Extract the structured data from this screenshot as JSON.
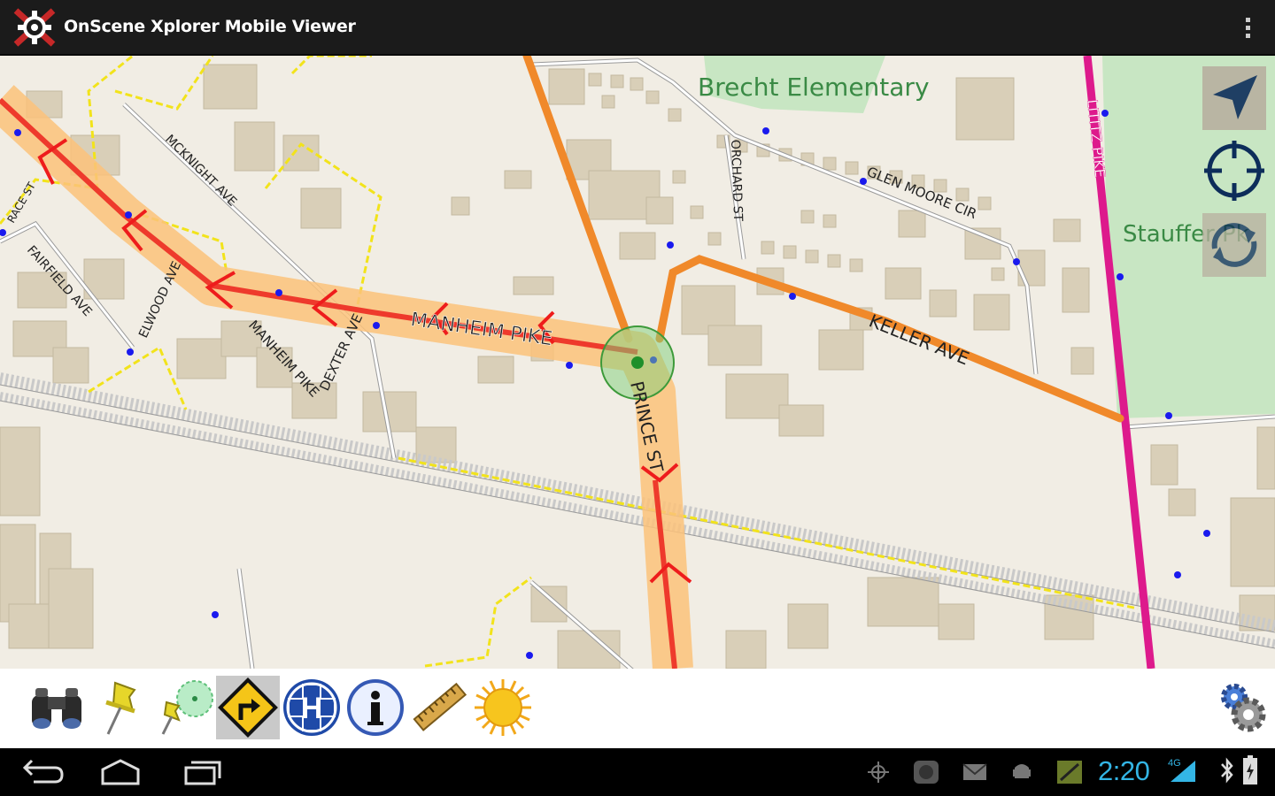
{
  "app": {
    "title": "OnScene Xplorer Mobile Viewer",
    "icon": "onscene-logo-icon"
  },
  "actionbar": {
    "overflow_icon": "overflow-menu-icon"
  },
  "map": {
    "labels": {
      "school": "Brecht Elementary",
      "park": "Stauffer Pk",
      "manheim_pike_main": "MANHEIM PIKE",
      "manheim_pike_side": "MANHEIM PIKE",
      "prince_st": "PRINCE ST",
      "keller_ave": "KELLER AVE",
      "lititz_pike": "LITITZ PIKE",
      "orchard_st": "ORCHARD ST",
      "glen_moore": "GLEN MOORE CIR",
      "mcknight": "MCKNIGHT AVE",
      "fairfield": "FAIRFIELD AVE",
      "dexter": "DEXTER AVE",
      "elwood": "ELWOOD AVE",
      "race_st": "RACE ST"
    },
    "colors": {
      "background": "#f1ede4",
      "building": "#d9cfb8",
      "route_highlight": "#fbc27a",
      "route_line": "#ee3a2c",
      "arterial": "#f0892a",
      "highway": "#dd1a8c",
      "park": "#c8e6c3",
      "boundary": "#f2e31b",
      "hydrant": "#1a1aee"
    },
    "controls": {
      "navigate": "navigation-arrow-icon",
      "locate": "crosshair-locate-icon",
      "refresh": "refresh-icon"
    }
  },
  "toolbar": {
    "tools": [
      {
        "name": "binoculars-icon",
        "selected": false
      },
      {
        "name": "pushpin-icon",
        "selected": false
      },
      {
        "name": "pushpin-radius-icon",
        "selected": false
      },
      {
        "name": "route-directions-icon",
        "selected": true
      },
      {
        "name": "hospital-icon",
        "selected": false
      },
      {
        "name": "info-icon",
        "selected": false
      },
      {
        "name": "ruler-icon",
        "selected": false
      },
      {
        "name": "weather-sun-icon",
        "selected": false
      }
    ],
    "settings": "settings-gears-icon"
  },
  "statusbar": {
    "time": "2:20",
    "signal": "4G"
  }
}
